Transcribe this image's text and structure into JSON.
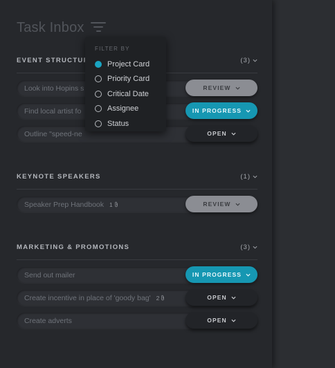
{
  "header": {
    "title": "Task Inbox",
    "filter_icon": "filter-icon"
  },
  "filter_dropdown": {
    "heading": "FILTER BY",
    "options": [
      {
        "label": "Project Card",
        "selected": true
      },
      {
        "label": "Priority Card",
        "selected": false
      },
      {
        "label": "Critical Date",
        "selected": false
      },
      {
        "label": "Assignee",
        "selected": false
      },
      {
        "label": "Status",
        "selected": false
      }
    ]
  },
  "sections": [
    {
      "title": "EVENT STRUCTURE",
      "count": "(3)",
      "tasks": [
        {
          "text": "Look into Hopins s",
          "attachments": "",
          "status": "REVIEW"
        },
        {
          "text": "Find local artist fo",
          "attachments": "",
          "status": "IN PROGRESS"
        },
        {
          "text": "Outline \"speed-ne",
          "attachments": "",
          "status": "OPEN"
        }
      ]
    },
    {
      "title": "KEYNOTE SPEAKERS",
      "count": "(1)",
      "tasks": [
        {
          "text": "Speaker Prep Handbook",
          "attachments": "1",
          "status": "REVIEW"
        }
      ]
    },
    {
      "title": "MARKETING & PROMOTIONS",
      "count": "(3)",
      "tasks": [
        {
          "text": "Send out mailer",
          "attachments": "",
          "status": "IN PROGRESS"
        },
        {
          "text": "Create incentive in place of 'goody bag'",
          "attachments": "2",
          "status": "OPEN"
        },
        {
          "text": "Create adverts",
          "attachments": "",
          "status": "OPEN"
        }
      ]
    }
  ],
  "colors": {
    "accent": "#1697b2",
    "review": "#8b8d93",
    "open": "#222428",
    "panel": "#26282c"
  }
}
